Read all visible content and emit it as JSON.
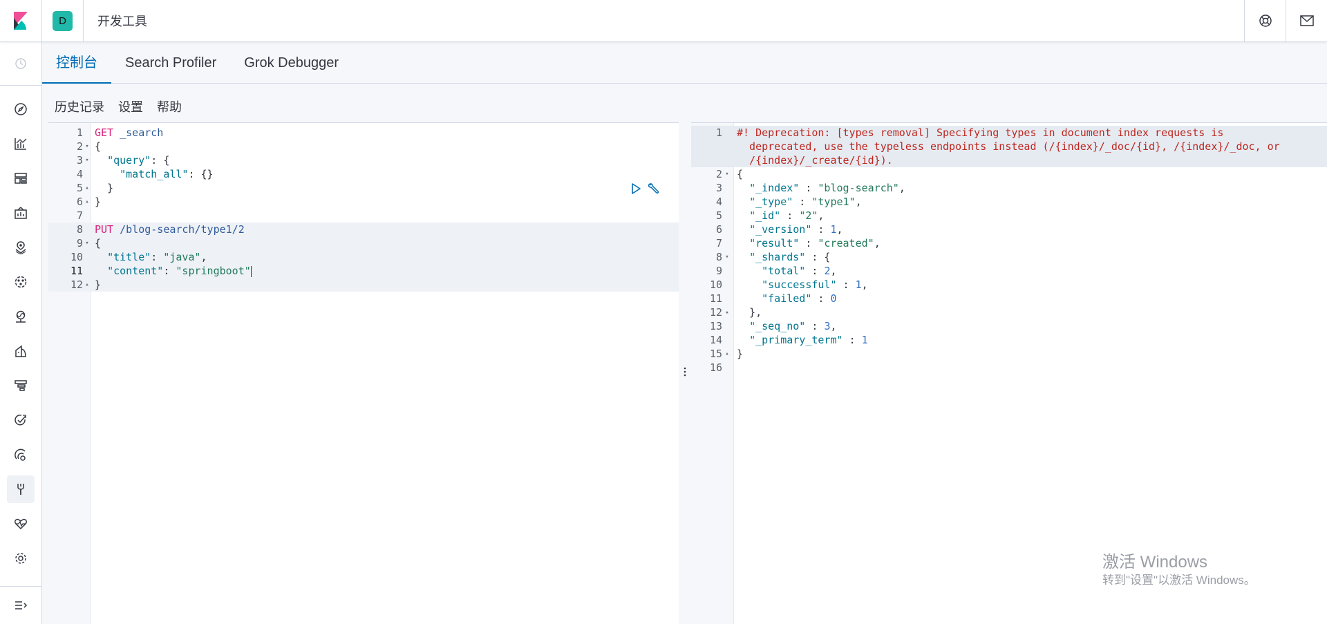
{
  "header": {
    "space_initial": "D",
    "app_title": "开发工具",
    "right_icons": [
      "help-icon",
      "newsfeed-icon"
    ]
  },
  "sidebar": {
    "items": [
      {
        "name": "discover",
        "icon": "compass-icon"
      },
      {
        "name": "visualize",
        "icon": "chart-icon"
      },
      {
        "name": "dashboard",
        "icon": "dashboard-icon"
      },
      {
        "name": "canvas",
        "icon": "canvas-icon"
      },
      {
        "name": "maps",
        "icon": "maps-icon"
      },
      {
        "name": "machine-learning",
        "icon": "ml-icon"
      },
      {
        "name": "infrastructure",
        "icon": "infra-icon"
      },
      {
        "name": "logs",
        "icon": "logs-icon"
      },
      {
        "name": "apm",
        "icon": "apm-icon"
      },
      {
        "name": "uptime",
        "icon": "uptime-icon"
      },
      {
        "name": "siem",
        "icon": "siem-icon"
      },
      {
        "name": "dev-tools",
        "icon": "wrench-icon",
        "active": true
      },
      {
        "name": "monitoring",
        "icon": "heartbeat-icon"
      },
      {
        "name": "management",
        "icon": "gear-icon"
      }
    ]
  },
  "tabs": [
    {
      "label": "控制台",
      "selected": true
    },
    {
      "label": "Search Profiler",
      "selected": false
    },
    {
      "label": "Grok Debugger",
      "selected": false
    }
  ],
  "subnav": {
    "history": "历史记录",
    "settings": "设置",
    "help": "帮助"
  },
  "request": {
    "lines": [
      {
        "n": "1",
        "fold": "",
        "segments": [
          {
            "c": "kw",
            "t": "GET"
          },
          {
            "c": "url",
            "t": " _search"
          }
        ]
      },
      {
        "n": "2",
        "fold": "down",
        "segments": [
          {
            "c": "pun",
            "t": "{"
          }
        ]
      },
      {
        "n": "3",
        "fold": "down",
        "segments": [
          {
            "c": "pun",
            "t": "  "
          },
          {
            "c": "key",
            "t": "\"query\""
          },
          {
            "c": "pun",
            "t": ": {"
          }
        ]
      },
      {
        "n": "4",
        "fold": "",
        "segments": [
          {
            "c": "pun",
            "t": "    "
          },
          {
            "c": "key",
            "t": "\"match_all\""
          },
          {
            "c": "pun",
            "t": ": {}"
          }
        ]
      },
      {
        "n": "5",
        "fold": "up",
        "segments": [
          {
            "c": "pun",
            "t": "  }"
          }
        ]
      },
      {
        "n": "6",
        "fold": "up",
        "segments": [
          {
            "c": "pun",
            "t": "}"
          }
        ]
      },
      {
        "n": "7",
        "fold": "",
        "segments": []
      },
      {
        "n": "8",
        "fold": "",
        "segments": [
          {
            "c": "kw",
            "t": "PUT"
          },
          {
            "c": "url",
            "t": " /blog-search/type1/2"
          }
        ]
      },
      {
        "n": "9",
        "fold": "down",
        "segments": [
          {
            "c": "pun",
            "t": "{"
          }
        ]
      },
      {
        "n": "10",
        "fold": "",
        "segments": [
          {
            "c": "pun",
            "t": "  "
          },
          {
            "c": "key",
            "t": "\"title\""
          },
          {
            "c": "pun",
            "t": ": "
          },
          {
            "c": "str",
            "t": "\"java\""
          },
          {
            "c": "pun",
            "t": ","
          }
        ]
      },
      {
        "n": "11",
        "fold": "",
        "segments": [
          {
            "c": "pun",
            "t": "  "
          },
          {
            "c": "key",
            "t": "\"content\""
          },
          {
            "c": "pun",
            "t": ": "
          },
          {
            "c": "str",
            "t": "\"springboot\""
          }
        ]
      },
      {
        "n": "12",
        "fold": "up",
        "segments": [
          {
            "c": "pun",
            "t": "}"
          }
        ]
      }
    ]
  },
  "response": {
    "lines": [
      {
        "n": "1",
        "fold": "",
        "segments": [
          {
            "c": "warn",
            "t": "#! Deprecation: [types removal] Specifying types in document index requests is"
          }
        ]
      },
      {
        "n": "",
        "fold": "",
        "segments": [
          {
            "c": "warn",
            "t": "  deprecated, use the typeless endpoints instead (/{index}/_doc/{id}, /{index}/_doc, or"
          }
        ]
      },
      {
        "n": "",
        "fold": "",
        "segments": [
          {
            "c": "warn",
            "t": "  /{index}/_create/{id})."
          }
        ]
      },
      {
        "n": "2",
        "fold": "down",
        "segments": [
          {
            "c": "pun",
            "t": "{"
          }
        ]
      },
      {
        "n": "3",
        "fold": "",
        "segments": [
          {
            "c": "pun",
            "t": "  "
          },
          {
            "c": "key",
            "t": "\"_index\""
          },
          {
            "c": "pun",
            "t": " : "
          },
          {
            "c": "str",
            "t": "\"blog-search\""
          },
          {
            "c": "pun",
            "t": ","
          }
        ]
      },
      {
        "n": "4",
        "fold": "",
        "segments": [
          {
            "c": "pun",
            "t": "  "
          },
          {
            "c": "key",
            "t": "\"_type\""
          },
          {
            "c": "pun",
            "t": " : "
          },
          {
            "c": "str",
            "t": "\"type1\""
          },
          {
            "c": "pun",
            "t": ","
          }
        ]
      },
      {
        "n": "5",
        "fold": "",
        "segments": [
          {
            "c": "pun",
            "t": "  "
          },
          {
            "c": "key",
            "t": "\"_id\""
          },
          {
            "c": "pun",
            "t": " : "
          },
          {
            "c": "str",
            "t": "\"2\""
          },
          {
            "c": "pun",
            "t": ","
          }
        ]
      },
      {
        "n": "6",
        "fold": "",
        "segments": [
          {
            "c": "pun",
            "t": "  "
          },
          {
            "c": "key",
            "t": "\"_version\""
          },
          {
            "c": "pun",
            "t": " : "
          },
          {
            "c": "num",
            "t": "1"
          },
          {
            "c": "pun",
            "t": ","
          }
        ]
      },
      {
        "n": "7",
        "fold": "",
        "segments": [
          {
            "c": "pun",
            "t": "  "
          },
          {
            "c": "key",
            "t": "\"result\""
          },
          {
            "c": "pun",
            "t": " : "
          },
          {
            "c": "str",
            "t": "\"created\""
          },
          {
            "c": "pun",
            "t": ","
          }
        ]
      },
      {
        "n": "8",
        "fold": "down",
        "segments": [
          {
            "c": "pun",
            "t": "  "
          },
          {
            "c": "key",
            "t": "\"_shards\""
          },
          {
            "c": "pun",
            "t": " : {"
          }
        ]
      },
      {
        "n": "9",
        "fold": "",
        "segments": [
          {
            "c": "pun",
            "t": "    "
          },
          {
            "c": "key",
            "t": "\"total\""
          },
          {
            "c": "pun",
            "t": " : "
          },
          {
            "c": "num",
            "t": "2"
          },
          {
            "c": "pun",
            "t": ","
          }
        ]
      },
      {
        "n": "10",
        "fold": "",
        "segments": [
          {
            "c": "pun",
            "t": "    "
          },
          {
            "c": "key",
            "t": "\"successful\""
          },
          {
            "c": "pun",
            "t": " : "
          },
          {
            "c": "num",
            "t": "1"
          },
          {
            "c": "pun",
            "t": ","
          }
        ]
      },
      {
        "n": "11",
        "fold": "",
        "segments": [
          {
            "c": "pun",
            "t": "    "
          },
          {
            "c": "key",
            "t": "\"failed\""
          },
          {
            "c": "pun",
            "t": " : "
          },
          {
            "c": "num",
            "t": "0"
          }
        ]
      },
      {
        "n": "12",
        "fold": "up",
        "segments": [
          {
            "c": "pun",
            "t": "  },"
          }
        ]
      },
      {
        "n": "13",
        "fold": "",
        "segments": [
          {
            "c": "pun",
            "t": "  "
          },
          {
            "c": "key",
            "t": "\"_seq_no\""
          },
          {
            "c": "pun",
            "t": " : "
          },
          {
            "c": "num",
            "t": "3"
          },
          {
            "c": "pun",
            "t": ","
          }
        ]
      },
      {
        "n": "14",
        "fold": "",
        "segments": [
          {
            "c": "pun",
            "t": "  "
          },
          {
            "c": "key",
            "t": "\"_primary_term\""
          },
          {
            "c": "pun",
            "t": " : "
          },
          {
            "c": "num",
            "t": "1"
          }
        ]
      },
      {
        "n": "15",
        "fold": "up",
        "segments": [
          {
            "c": "pun",
            "t": "}"
          }
        ]
      },
      {
        "n": "16",
        "fold": "",
        "segments": []
      }
    ]
  },
  "watermark": {
    "title": "激活 Windows",
    "subtitle": "转到\"设置\"以激活 Windows。"
  },
  "colors": {
    "accent": "#006bb4",
    "method": "#d7247c",
    "key": "#00768f",
    "string": "#227a5a",
    "warning": "#bd271e"
  }
}
